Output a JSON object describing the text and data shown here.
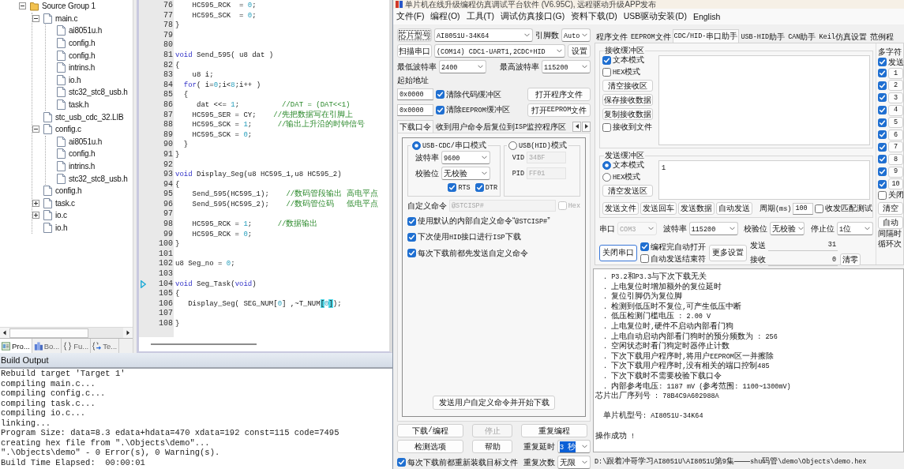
{
  "ide": {
    "project_tree": [
      {
        "kind": "folder",
        "label": "Source Group 1",
        "expanded": true,
        "children": [
          {
            "kind": "file",
            "label": "main.c",
            "expanded": true,
            "children": [
              {
                "kind": "file",
                "label": "ai8051u.h"
              },
              {
                "kind": "file",
                "label": "config.h"
              },
              {
                "kind": "file",
                "label": "config.h"
              },
              {
                "kind": "file",
                "label": "intrins.h"
              },
              {
                "kind": "file",
                "label": "io.h"
              },
              {
                "kind": "file",
                "label": "stc32_stc8_usb.h"
              },
              {
                "kind": "file",
                "label": "task.h"
              }
            ]
          },
          {
            "kind": "file",
            "label": "stc_usb_cdc_32.LIB"
          },
          {
            "kind": "file",
            "label": "config.c",
            "expanded": true,
            "children": [
              {
                "kind": "file",
                "label": "ai8051u.h"
              },
              {
                "kind": "file",
                "label": "config.h"
              },
              {
                "kind": "file",
                "label": "intrins.h"
              },
              {
                "kind": "file",
                "label": "stc32_stc8_usb.h"
              }
            ]
          },
          {
            "kind": "file",
            "label": "config.h"
          },
          {
            "kind": "file",
            "label": "task.c",
            "expanded": false
          },
          {
            "kind": "file",
            "label": "io.c",
            "expanded": false
          },
          {
            "kind": "file",
            "label": "io.h"
          }
        ]
      }
    ],
    "panel_tabs": [
      {
        "kind": "project",
        "label": "Pro...",
        "selected": true
      },
      {
        "kind": "books",
        "label": "Bo...",
        "selected": false
      },
      {
        "kind": "functions",
        "label": "Fu...",
        "selected": false
      },
      {
        "kind": "templates",
        "label": "Te...",
        "selected": false
      }
    ],
    "editor": {
      "lines": [
        {
          "number": "76",
          "marker": false,
          "tokens": [
            {
              "kind": "plain",
              "text": "    HC595_RCK  = "
            },
            {
              "kind": "number",
              "text": "0"
            },
            {
              "kind": "plain",
              "text": ";"
            }
          ]
        },
        {
          "number": "77",
          "marker": false,
          "tokens": [
            {
              "kind": "plain",
              "text": "    HC595_SCK  = "
            },
            {
              "kind": "number",
              "text": "0"
            },
            {
              "kind": "plain",
              "text": ";"
            }
          ]
        },
        {
          "number": "78",
          "marker": false,
          "tokens": [
            {
              "kind": "plain",
              "text": "}"
            }
          ]
        },
        {
          "number": "79",
          "marker": false
        },
        {
          "number": "80",
          "marker": false
        },
        {
          "number": "81",
          "marker": false,
          "tokens": [
            {
              "kind": "keyword",
              "text": "void"
            },
            {
              "kind": "plain",
              "text": " Send_595( u8 dat )"
            }
          ]
        },
        {
          "number": "82",
          "marker": false,
          "tokens": [
            {
              "kind": "plain",
              "text": "{"
            }
          ]
        },
        {
          "number": "83",
          "marker": false,
          "tokens": [
            {
              "kind": "plain",
              "text": "    u8 i;"
            }
          ]
        },
        {
          "number": "84",
          "marker": false,
          "tokens": [
            {
              "kind": "keyword",
              "text": "  for"
            },
            {
              "kind": "plain",
              "text": "( i="
            },
            {
              "kind": "number",
              "text": "0"
            },
            {
              "kind": "plain",
              "text": ";i<"
            },
            {
              "kind": "number",
              "text": "8"
            },
            {
              "kind": "plain",
              "text": ";i++ )"
            }
          ]
        },
        {
          "number": "85",
          "marker": false,
          "tokens": [
            {
              "kind": "plain",
              "text": "  {"
            }
          ]
        },
        {
          "number": "86",
          "marker": false,
          "tokens": [
            {
              "kind": "plain",
              "text": "     dat <<= "
            },
            {
              "kind": "number",
              "text": "1"
            },
            {
              "kind": "plain",
              "text": ";          "
            },
            {
              "kind": "comment",
              "text": "//DAT = (DAT<<1)"
            }
          ]
        },
        {
          "number": "87",
          "marker": false,
          "tokens": [
            {
              "kind": "plain",
              "text": "    HC595_SER = CY;    "
            },
            {
              "kind": "comment",
              "text": "//先把数据写在引脚上"
            }
          ]
        },
        {
          "number": "88",
          "marker": false,
          "tokens": [
            {
              "kind": "plain",
              "text": "    HC595_SCK = "
            },
            {
              "kind": "number",
              "text": "1"
            },
            {
              "kind": "plain",
              "text": ";      "
            },
            {
              "kind": "comment",
              "text": "//输出上升沿的时钟信号"
            }
          ]
        },
        {
          "number": "89",
          "marker": false,
          "tokens": [
            {
              "kind": "plain",
              "text": "    HC595_SCK = "
            },
            {
              "kind": "number",
              "text": "0"
            },
            {
              "kind": "plain",
              "text": ";"
            }
          ]
        },
        {
          "number": "90",
          "marker": false,
          "tokens": [
            {
              "kind": "plain",
              "text": "  }"
            }
          ]
        },
        {
          "number": "91",
          "marker": false,
          "tokens": [
            {
              "kind": "plain",
              "text": "}"
            }
          ]
        },
        {
          "number": "92",
          "marker": false
        },
        {
          "number": "93",
          "marker": false,
          "tokens": [
            {
              "kind": "keyword",
              "text": "void"
            },
            {
              "kind": "plain",
              "text": " Display_Seg(u8 HC595_1,u8 HC595_2)"
            }
          ]
        },
        {
          "number": "94",
          "marker": false,
          "tokens": [
            {
              "kind": "plain",
              "text": "{"
            }
          ]
        },
        {
          "number": "95",
          "marker": false,
          "tokens": [
            {
              "kind": "plain",
              "text": "    Send_595(HC595_1);    "
            },
            {
              "kind": "comment",
              "text": "//数码管段输出 高电平点"
            }
          ]
        },
        {
          "number": "96",
          "marker": false,
          "tokens": [
            {
              "kind": "plain",
              "text": "    Send_595(HC595_2);    "
            },
            {
              "kind": "comment",
              "text": "//数码管位码   低电平点"
            }
          ]
        },
        {
          "number": "97",
          "marker": false
        },
        {
          "number": "98",
          "marker": false,
          "tokens": [
            {
              "kind": "plain",
              "text": "    HC595_RCK = "
            },
            {
              "kind": "number",
              "text": "1"
            },
            {
              "kind": "plain",
              "text": ";      "
            },
            {
              "kind": "comment",
              "text": "//数据输出"
            }
          ]
        },
        {
          "number": "99",
          "marker": false,
          "tokens": [
            {
              "kind": "plain",
              "text": "    HC595_RCK = "
            },
            {
              "kind": "number",
              "text": "0"
            },
            {
              "kind": "plain",
              "text": ";"
            }
          ]
        },
        {
          "number": "100",
          "marker": false,
          "tokens": [
            {
              "kind": "plain",
              "text": "}"
            }
          ]
        },
        {
          "number": "101",
          "marker": false
        },
        {
          "number": "102",
          "marker": false,
          "tokens": [
            {
              "kind": "plain",
              "text": "u8 Seg_no = "
            },
            {
              "kind": "number",
              "text": "0"
            },
            {
              "kind": "plain",
              "text": ";"
            }
          ]
        },
        {
          "number": "103",
          "marker": false
        },
        {
          "number": "104",
          "marker": true,
          "tokens": [
            {
              "kind": "keyword",
              "text": "void"
            },
            {
              "kind": "plain",
              "text": " Seg_Task("
            },
            {
              "kind": "keyword",
              "text": "void"
            },
            {
              "kind": "plain",
              "text": ")"
            }
          ]
        },
        {
          "number": "105",
          "marker": false,
          "tokens": [
            {
              "kind": "plain",
              "text": "{"
            }
          ]
        },
        {
          "number": "106",
          "marker": false,
          "tokens": [
            {
              "kind": "plain",
              "text": "   Display_Seg( SEG_NUM["
            },
            {
              "kind": "number",
              "text": "0"
            },
            {
              "kind": "plain",
              "text": "] ,~T_NUM"
            },
            {
              "kind": "match",
              "text": "["
            },
            {
              "kind": "number",
              "text": "0"
            },
            {
              "kind": "match",
              "text": "]"
            },
            {
              "kind": "plain",
              "text": ");"
            }
          ]
        },
        {
          "number": "107",
          "marker": false
        },
        {
          "number": "108",
          "marker": false,
          "tokens": [
            {
              "kind": "plain",
              "text": "}"
            }
          ]
        }
      ]
    },
    "build_output": {
      "title": "Build Output",
      "lines": [
        "Rebuild target 'Target 1'",
        "compiling main.c...",
        "compiling config.c...",
        "compiling task.c...",
        "compiling io.c...",
        "linking...",
        "Program Size: data=8.3 edata+hdata=470 xdata=192 const=115 code=7495",
        "creating hex file from \".\\Objects\\demo\"...",
        "\".\\Objects\\demo\" - 0 Error(s), 0 Warning(s).",
        "Build Time Elapsed:  00:00:01"
      ]
    }
  },
  "isp": {
    "title": "单片机在线升级编程仿真调试平台软件 (V6.95C), 远程驱动升级APP发布",
    "menu": [
      "文件(F)",
      "编程(O)",
      "工具(T)",
      "调试仿真接口(G)",
      "资料下载(D)",
      "USB驱动安装(D)",
      "English"
    ],
    "chip": {
      "button": "芯片型号",
      "button_focused": true,
      "value": "AI8051U-34K64",
      "pins_label": "引脚数",
      "pins_value": "Auto"
    },
    "port": {
      "button": "扫描串口",
      "value": "(COM14) CDC1-UART1,2CDC+HID",
      "settings_button": "设置"
    },
    "baud": {
      "min_label": "最低波特率",
      "min_value": "2400",
      "max_label": "最高波特率",
      "max_value": "115200"
    },
    "start_address": {
      "label": "起始地址",
      "rows": [
        {
          "value": "0x0000",
          "clear": {
            "label": "清除代码缓冲区",
            "checked": true
          },
          "button": "打开程序文件"
        },
        {
          "value": "0x0000",
          "clear": {
            "label": "清除EEPROM缓冲区",
            "checked": true
          },
          "button": "打开EEPROM文件"
        }
      ]
    },
    "option_tabs": [
      {
        "label": "下载口令",
        "selected": true
      },
      {
        "label": "收到用户命令后复位到ISP监控程序区",
        "selected": false
      }
    ],
    "download_command": {
      "cdc_mode": {
        "label": "USB-CDC/串口模式",
        "selected": true,
        "baud_label": "波特率",
        "baud_value": "9600",
        "parity_label": "校验位",
        "parity_value": "无校验",
        "signals": [
          {
            "label": "RTS",
            "checked": true
          },
          {
            "label": "DTR",
            "checked": true
          }
        ]
      },
      "hid_mode": {
        "label": "USB(HID)模式",
        "selected": false,
        "vid_label": "VID",
        "vid_value": "34BF",
        "pid_label": "PID",
        "pid_value": "FF01"
      },
      "custom_command": {
        "label": "自定义命令",
        "value": "@STCISP#",
        "disabled": true,
        "hex": {
          "label": "Hex",
          "checked": false
        }
      },
      "options": [
        {
          "label": "使用默认的内部自定义命令“@STCISP#”",
          "checked": true
        },
        {
          "label": "下次使用HID接口进行ISP下载",
          "checked": true
        },
        {
          "label": "每次下载前都先发送自定义命令",
          "checked": true
        }
      ],
      "send_button": "发送用户自定义命令并开始下载"
    },
    "actions": [
      {
        "label": "下载/编程",
        "disabled": false
      },
      {
        "label": "停止",
        "disabled": true
      },
      {
        "label": "重复编程",
        "disabled": false
      },
      {
        "label": "检测选项",
        "disabled": false
      },
      {
        "label": "帮助",
        "disabled": false
      }
    ],
    "repeat_delay": {
      "label": "重复延时",
      "value": "3 秒",
      "highlighted": true
    },
    "reload_option": {
      "label": "每次下载前都重新装载目标文件",
      "checked": true
    },
    "repeat_count": {
      "label": "重复次数",
      "value": "无限"
    },
    "tool_tabs": [
      {
        "label": "程序文件",
        "selected": false
      },
      {
        "label": "EEPROM文件",
        "selected": false
      },
      {
        "label": "CDC/HID-串口助手",
        "selected": true
      },
      {
        "label": "USB-HID助手",
        "selected": false
      },
      {
        "label": "CAN助手",
        "selected": false
      },
      {
        "label": "Keil仿真设置",
        "selected": false
      },
      {
        "label": "范例程",
        "selected": false
      }
    ],
    "receive": {
      "title": "接收缓冲区",
      "modes": [
        {
          "label": "文本模式",
          "checked": true
        },
        {
          "label": "HEX模式",
          "checked": false
        }
      ],
      "buttons": [
        "清空接收区",
        "保存接收数据",
        "复制接收数据"
      ],
      "to_file": {
        "label": "接收到文件",
        "checked": false
      }
    },
    "send": {
      "title": "发送缓冲区",
      "modes": [
        {
          "label": "文本模式",
          "selected": true
        },
        {
          "label": "HEX模式",
          "selected": false
        }
      ],
      "clear_button": "清空发送区",
      "value": "1",
      "buttons": [
        "发送文件",
        "发送回车",
        "发送数据",
        "自动发送"
      ],
      "period_label": "周期(ms)",
      "period_value": "100",
      "match_test": {
        "label": "收发匹配测试",
        "checked": false
      }
    },
    "serial": {
      "port_label": "串口",
      "port_value": "COM3",
      "port_disabled": true,
      "baud_label": "波特率",
      "baud_value": "115200",
      "parity_label": "校验位",
      "parity_value": "无校验",
      "stop_label": "停止位",
      "stop_value": "1位"
    },
    "serial_actions": {
      "close_button": "关闭串口",
      "close_focused": true,
      "auto_open": {
        "label": "编程完自动打开",
        "checked": true
      },
      "auto_end": {
        "label": "自动发送结束符",
        "checked": false
      },
      "more_button": "更多设置",
      "sent_label": "发送",
      "sent_value": "31",
      "received_label": "接收",
      "received_value": "0",
      "reset_button": "清零"
    },
    "multi_send": {
      "title": "多字符",
      "send": {
        "label": "发送",
        "checked": true
      },
      "items": [
        {
          "label": "1",
          "checked": true
        },
        {
          "label": "2",
          "checked": true
        },
        {
          "label": "3",
          "checked": true
        },
        {
          "label": "4",
          "checked": true
        },
        {
          "label": "5",
          "checked": true
        },
        {
          "label": "6",
          "checked": true
        },
        {
          "label": "7",
          "checked": true
        },
        {
          "label": "8",
          "checked": true
        },
        {
          "label": "9",
          "checked": true
        },
        {
          "label": "10",
          "checked": true
        }
      ],
      "close": {
        "label": "关闭",
        "checked": false
      },
      "clear_button": "清空",
      "auto_button": "自动",
      "interval_label": "间隔时",
      "loop_label": "循环次"
    },
    "log": [
      {
        "kind": "item",
        "text": ". P3.2和P3.3与下次下载无关"
      },
      {
        "kind": "item",
        "text": ". 上电复位时增加额外的复位延时"
      },
      {
        "kind": "item",
        "text": ". 复位引脚仍为复位脚"
      },
      {
        "kind": "item",
        "text": ". 检测到低压时不复位,可产生低压中断"
      },
      {
        "kind": "item",
        "text": ". 低压检测门槛电压 : 2.00 V"
      },
      {
        "kind": "item",
        "text": ". 上电复位时,硬件不启动内部看门狗"
      },
      {
        "kind": "item",
        "text": ". 上电自动启动内部看门狗时的预分频数为 : 256"
      },
      {
        "kind": "item",
        "text": ". 空闲状态时看门狗定时器停止计数"
      },
      {
        "kind": "item",
        "text": ". 下次下载用户程序时,将用户EEPROM区一并擦除"
      },
      {
        "kind": "item",
        "text": ". 下次下载用户程序时,没有相关的端口控制485"
      },
      {
        "kind": "item",
        "text": ". 下次下载时不需要校验下载口令"
      },
      {
        "kind": "item",
        "text": ". 内部参考电压: 1187 mV (参考范围: 1100~1300mV)"
      },
      {
        "kind": "line",
        "text": "芯片出厂序列号 : 78B4C9A602988A"
      },
      {
        "kind": "spaced-item",
        "text": "单片机型号: AI8051U-34K64"
      },
      {
        "kind": "spaced-line",
        "text": "操作成功 !"
      }
    ],
    "status_bar": "D:\\跟着冲哥学习AI8051U\\AI8051U第9集——shu码管\\demo\\Objects\\demo.hex"
  }
}
